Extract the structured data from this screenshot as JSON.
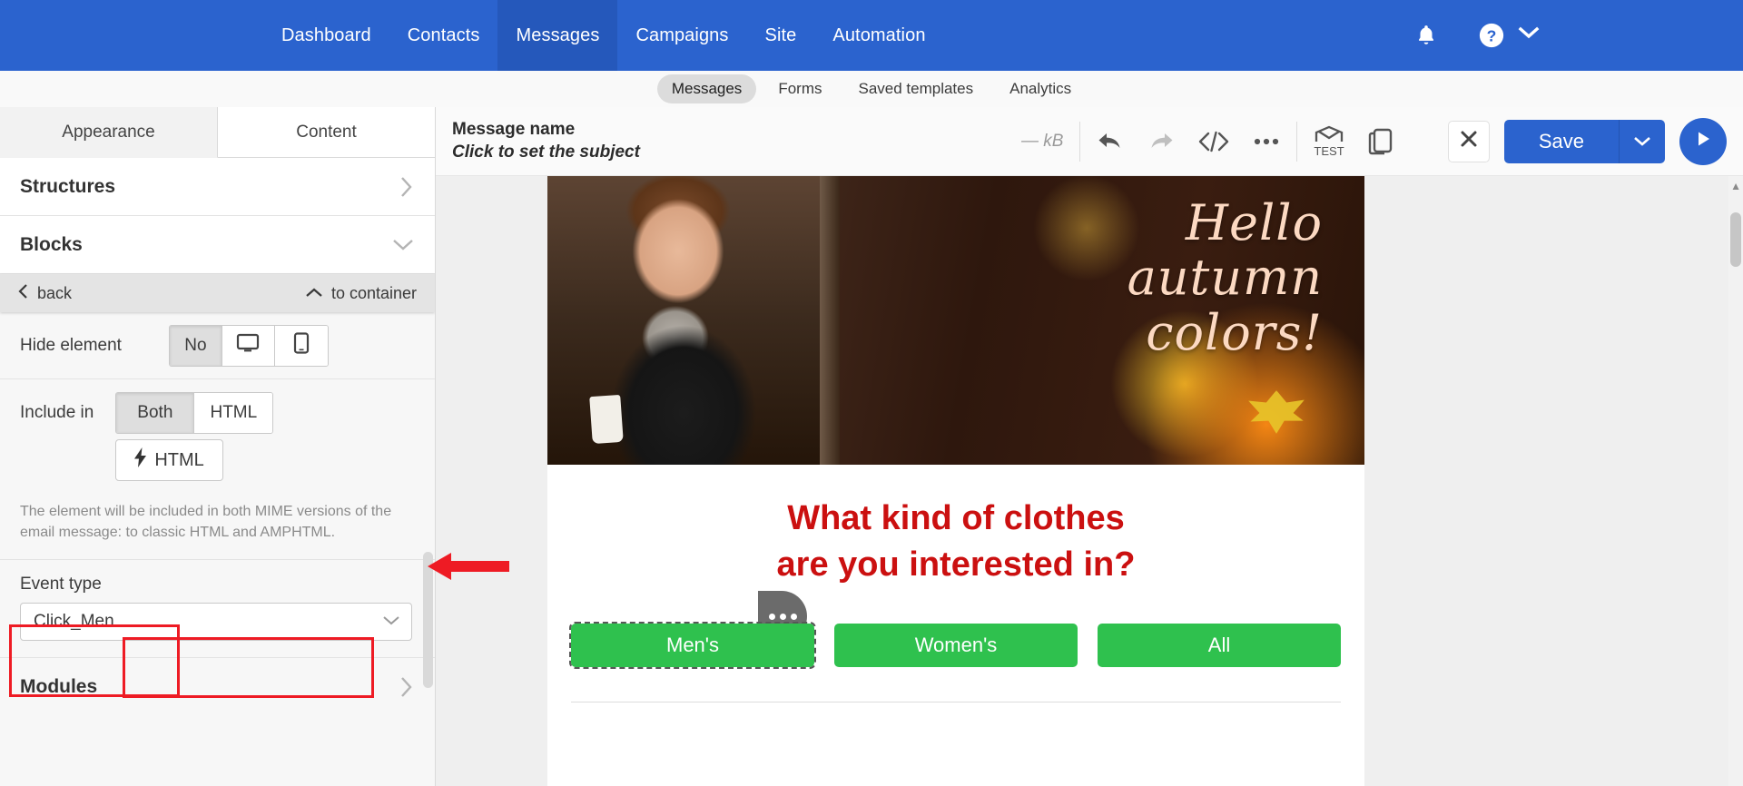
{
  "topnav": {
    "items": [
      {
        "label": "Dashboard",
        "active": false
      },
      {
        "label": "Contacts",
        "active": false
      },
      {
        "label": "Messages",
        "active": true
      },
      {
        "label": "Campaigns",
        "active": false
      },
      {
        "label": "Site",
        "active": false
      },
      {
        "label": "Automation",
        "active": false
      }
    ],
    "bell_icon": "bell-icon",
    "help_icon": "question-circle-icon",
    "account_caret_icon": "chevron-down-icon",
    "bg_color": "#2b63ce"
  },
  "subnav": {
    "items": [
      {
        "label": "Messages",
        "active": true
      },
      {
        "label": "Forms",
        "active": false
      },
      {
        "label": "Saved templates",
        "active": false
      },
      {
        "label": "Analytics",
        "active": false
      }
    ]
  },
  "sidebar": {
    "tabs": [
      {
        "label": "Appearance",
        "active": true
      },
      {
        "label": "Content",
        "active": false
      }
    ],
    "structures": {
      "label": "Structures",
      "icon": "chevron-right-icon"
    },
    "blocks": {
      "label": "Blocks",
      "icon": "chevron-down-icon"
    },
    "breadcrumb": {
      "back_label": "back",
      "back_icon": "chevron-left-icon",
      "to_container_label": "to container",
      "to_container_icon": "chevron-up-icon"
    },
    "hide_element": {
      "label": "Hide element",
      "options": [
        {
          "label": "No",
          "active": true,
          "icon": ""
        },
        {
          "label": "",
          "active": false,
          "icon": "desktop-icon"
        },
        {
          "label": "",
          "active": false,
          "icon": "mobile-icon"
        }
      ]
    },
    "include_in": {
      "label": "Include in",
      "options": [
        {
          "label": "Both",
          "active": true
        },
        {
          "label": "HTML",
          "active": false
        }
      ],
      "amp_label": "HTML",
      "amp_icon": "lightning-bolt-icon",
      "help_text": "The element will be included in both MIME versions of the email message: to classic HTML and AMPHTML."
    },
    "event_type": {
      "label": "Event type",
      "value": "Click_Men",
      "caret_icon": "chevron-down-icon",
      "highlight_color": "#ee1b24"
    },
    "modules": {
      "label": "Modules",
      "icon": "chevron-right-icon"
    }
  },
  "editor": {
    "message_name": "Message name",
    "message_subject": "Click to set the subject",
    "size": "— kB",
    "tools": [
      {
        "name": "undo-icon",
        "label": ""
      },
      {
        "name": "redo-icon",
        "label": ""
      },
      {
        "name": "code-icon",
        "label": ""
      },
      {
        "name": "more-icon",
        "label": ""
      }
    ],
    "tools_right": [
      {
        "name": "test-envelope-icon",
        "label": "TEST"
      },
      {
        "name": "duplicate-icon",
        "label": ""
      }
    ],
    "close_label": "✕",
    "close_icon": "close-icon",
    "save_label": "Save",
    "save_caret_icon": "chevron-down-icon",
    "play_icon": "play-icon",
    "accent_color": "#2b63ce"
  },
  "email": {
    "hero_text_lines": [
      "Hello",
      "autumn",
      "colors!"
    ],
    "heading_lines": [
      "What kind of clothes",
      "are you interested in?"
    ],
    "heading_color": "#cb1010",
    "buttons": [
      {
        "label": "Men's",
        "selected": true,
        "color": "#2fc14e"
      },
      {
        "label": "Women's",
        "selected": false,
        "color": "#2fc14e"
      },
      {
        "label": "All",
        "selected": false,
        "color": "#2fc14e"
      }
    ],
    "selected_button_menu_icon": "ellipsis-icon"
  },
  "annotations": {
    "arrow_color": "#ee1b24",
    "highlight_color": "#ee1b24"
  }
}
